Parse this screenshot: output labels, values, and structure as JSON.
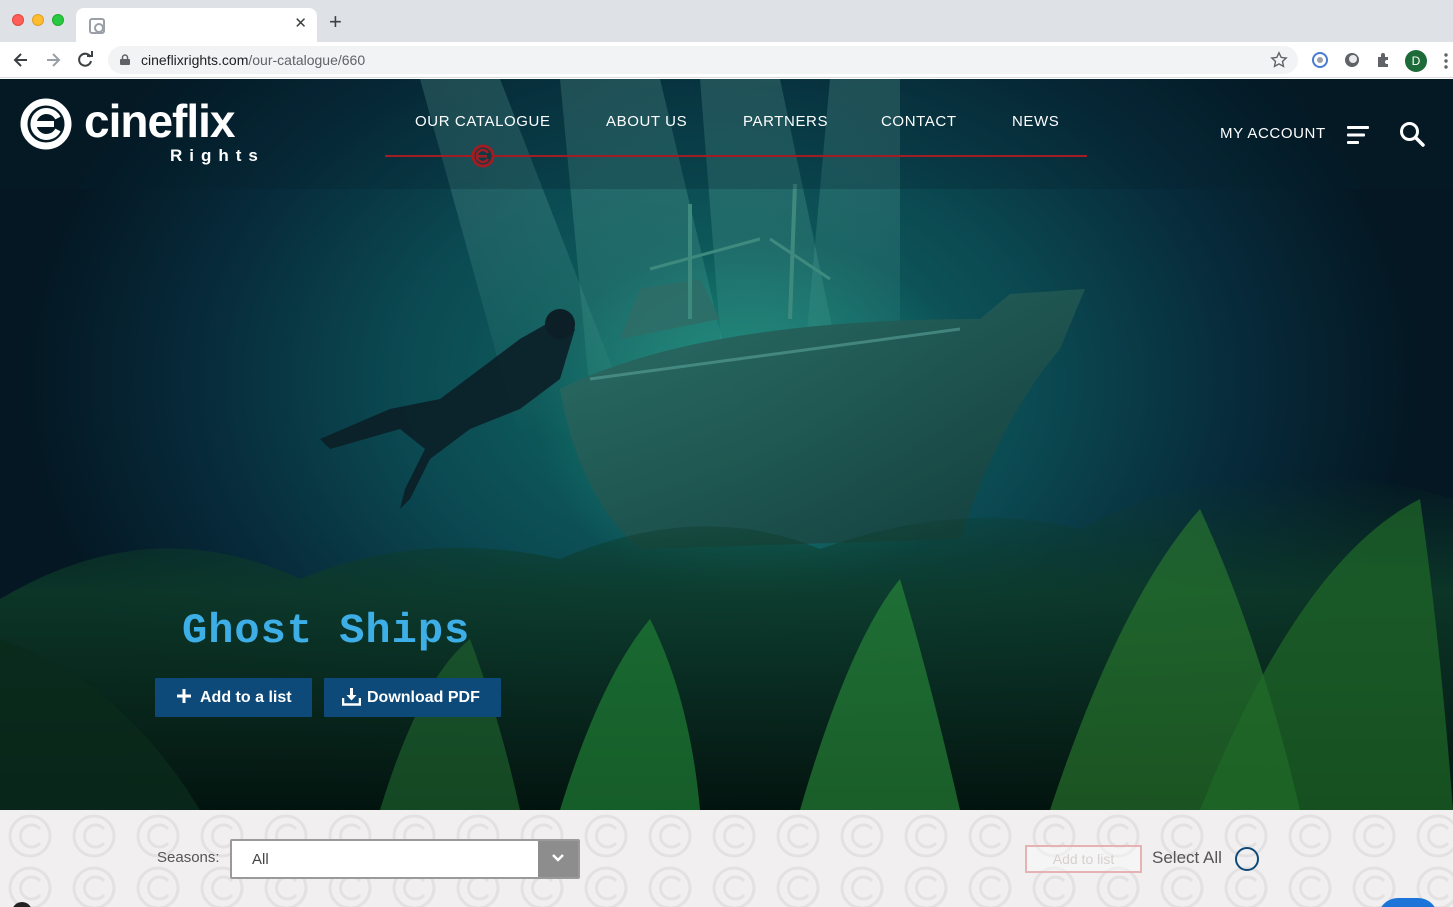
{
  "browser": {
    "tab_title": "",
    "close_glyph": "✕",
    "new_tab_glyph": "+",
    "url_host": "cineflixrights.com",
    "url_path": "/our-catalogue/660",
    "profile_initial": "D"
  },
  "site": {
    "logo_word": "cineflix",
    "logo_sub": "Rights",
    "nav": [
      {
        "label": "OUR CATALOGUE"
      },
      {
        "label": "ABOUT US"
      },
      {
        "label": "PARTNERS"
      },
      {
        "label": "CONTACT"
      },
      {
        "label": "NEWS"
      }
    ],
    "account_label": "MY ACCOUNT",
    "accent_color": "#a11d24"
  },
  "hero": {
    "title": "Ghost Ships",
    "add_button": "Add to a list",
    "pdf_button": "Download PDF"
  },
  "filters": {
    "seasons_label": "Seasons:",
    "seasons_value": "All",
    "add_to_list": "Add to list",
    "select_all": "Select All"
  }
}
